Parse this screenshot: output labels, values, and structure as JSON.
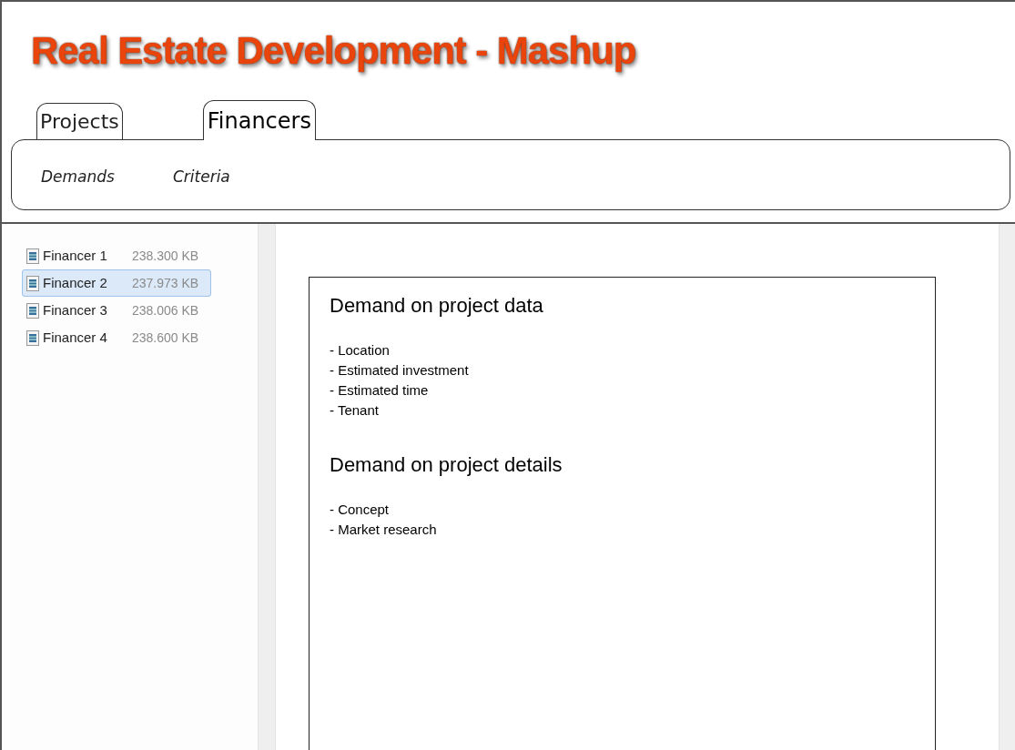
{
  "app": {
    "title": "Real Estate Development - Mashup"
  },
  "tabs": [
    {
      "label": "Projects",
      "selected": false
    },
    {
      "label": "Financers",
      "selected": true
    }
  ],
  "subnav": [
    "Demands",
    "Criteria"
  ],
  "files": [
    {
      "name": "Financer 1",
      "size": "238.300 KB",
      "selected": false
    },
    {
      "name": "Financer 2",
      "size": "237.973 KB",
      "selected": true
    },
    {
      "name": "Financer 3",
      "size": "238.006 KB",
      "selected": false
    },
    {
      "name": "Financer 4",
      "size": "238.600 KB",
      "selected": false
    }
  ],
  "document": {
    "sections": [
      {
        "heading": "Demand on project data",
        "items": [
          "- Location",
          "- Estimated investment",
          "- Estimated time",
          "- Tenant"
        ]
      },
      {
        "heading": "Demand on project details",
        "items": [
          "- Concept",
          "- Market research"
        ]
      }
    ]
  }
}
